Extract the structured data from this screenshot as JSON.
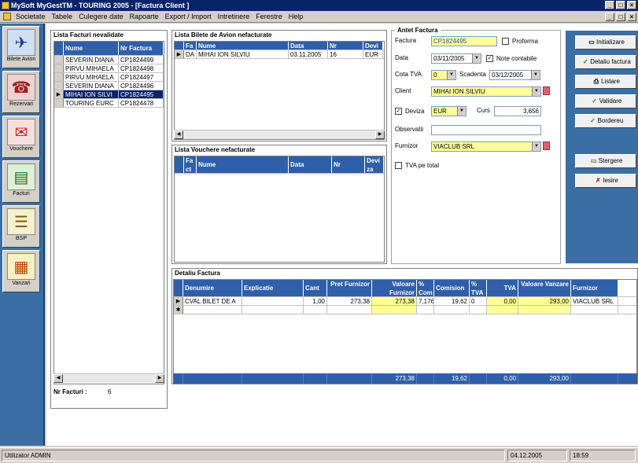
{
  "window": {
    "title": "MySoft MyGestTM - TOURING 2005 - [Factura Client ]"
  },
  "menu": [
    "Societate",
    "Tabele",
    "Culegere date",
    "Rapoarte",
    "Export / Import",
    "Intretinere",
    "Ferestre",
    "Help"
  ],
  "nav": [
    {
      "label": "Bilete Avion",
      "icon": "airplane-icon",
      "glyph": "✈"
    },
    {
      "label": "Rezervari",
      "icon": "reservation-icon",
      "glyph": "☎"
    },
    {
      "label": "Vouchere",
      "icon": "voucher-icon",
      "glyph": "✉"
    },
    {
      "label": "Facturi",
      "icon": "invoice-icon",
      "glyph": "▤"
    },
    {
      "label": "BSP",
      "icon": "bsp-icon",
      "glyph": "☰"
    },
    {
      "label": "Vanzari",
      "icon": "sales-icon",
      "glyph": "▦"
    }
  ],
  "facturi": {
    "title": "Lista Facturi nevalidate",
    "headers": [
      "Nume",
      "Nr Factura"
    ],
    "rows": [
      [
        "SEVERIN DIANA",
        "CP1824499"
      ],
      [
        "PIRVU MIHAELA",
        "CP1824498"
      ],
      [
        "PIRVU MIHAELA",
        "CP1824497"
      ],
      [
        "SEVERIN DIANA",
        "CP1824496"
      ],
      [
        "MIHAI ION SILVI",
        "CP1824495"
      ],
      [
        "TOURING EURC",
        "CP1824478"
      ]
    ],
    "count_label": "Nr Facturi :",
    "count": "6"
  },
  "bilete": {
    "title": "Lista Bilete de Avion nefacturate",
    "headers": [
      "Fa",
      "Nume",
      "Data",
      "Nr",
      "Devi"
    ],
    "rows": [
      [
        "DA",
        "MIHAI ION SILVIU",
        "03.11.2005",
        "16",
        "EUR"
      ]
    ]
  },
  "vouchere": {
    "title": "Lista Vouchere nefacturate",
    "headers": [
      "Fa ct",
      "Nume",
      "Data",
      "Nr",
      "Devi za"
    ]
  },
  "antet": {
    "title": "Antet Factura",
    "factura_label": "Factura",
    "factura": "CP1824495",
    "proforma_label": "Proforma",
    "data_label": "Data",
    "data": "03/11/2005",
    "note_label": "Note contabile",
    "cota_label": "Cota TVA",
    "cota": "0",
    "scadenta_label": "Scadenta",
    "scadenta": "03/12/2005",
    "client_label": "Client",
    "client": "MIHAI ION SILVIU",
    "deviza_label": "Deviza",
    "deviza": "EUR",
    "curs_label": "Curs",
    "curs": "3,656",
    "observatii_label": "Observatii",
    "furnizor_label": "Furnizor",
    "furnizor": "VIACLUB SRL",
    "tva_total_label": "TVA pe total"
  },
  "actions": [
    {
      "label": "Initializare",
      "icon": "new-icon",
      "glyph": "▭"
    },
    {
      "label": "Detaliu factura",
      "icon": "check-icon",
      "glyph": "✓"
    },
    {
      "label": "Listare",
      "icon": "printer-icon",
      "glyph": "⎙"
    },
    {
      "label": "Validare",
      "icon": "check-icon",
      "glyph": "✓"
    },
    {
      "label": "Bordereu",
      "icon": "check-icon",
      "glyph": "✓"
    },
    {
      "label": "Stergere",
      "icon": "delete-icon",
      "glyph": "▭"
    },
    {
      "label": "Iesire",
      "icon": "exit-icon",
      "glyph": "✗"
    }
  ],
  "detaliu": {
    "title": "Detaliu Factura",
    "headers": [
      "Denumire",
      "Explicatie",
      "Cant",
      "Pret Furnizor",
      "Valoare Furnizor",
      "% Com",
      "Comision",
      "% TVA",
      "TVA",
      "Valoare Vanzare",
      "Furnizor"
    ],
    "row": [
      "CVAL BILET DE A",
      "",
      "1,00",
      "273,38",
      "273,38",
      "7,176",
      "19,62",
      "0",
      "0,00",
      "293,00",
      "VIACLUB SRL"
    ],
    "totals": [
      "273,38",
      "19,62",
      "0,00",
      "293,00"
    ]
  },
  "status": {
    "user": "Utilizator ADMIN",
    "date": "04.12.2005",
    "time": "18:59"
  },
  "colors": {
    "accent": "#2f5fa8",
    "title": "#0a246a",
    "panel": "#3a6ea5",
    "highlight": "#ffff99"
  }
}
